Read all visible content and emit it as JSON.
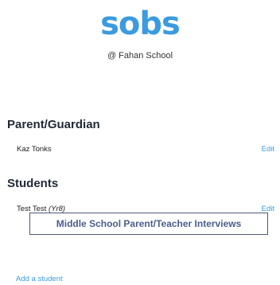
{
  "brand": {
    "logo_text": "sobs",
    "school_label": "@ Fahan School"
  },
  "colors": {
    "accent": "#3a9be0",
    "heading": "#1f2937",
    "button_text": "#4b5e8a",
    "button_border": "#4a5a7a"
  },
  "parent_section": {
    "title": "Parent/Guardian",
    "name": "Kaz Tonks",
    "edit_label": "Edit"
  },
  "students_section": {
    "title": "Students",
    "student_name": "Test Test",
    "student_year": "(Yr8)",
    "edit_label": "Edit"
  },
  "interviews_button": {
    "label": "Middle School Parent/Teacher Interviews"
  },
  "add_student": {
    "label": "Add a student"
  }
}
